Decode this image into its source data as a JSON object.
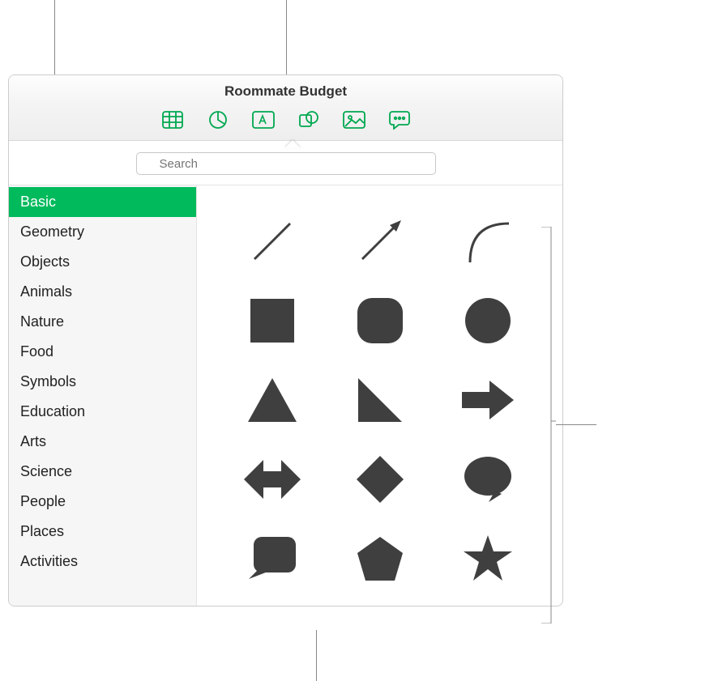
{
  "window": {
    "title": "Roommate Budget"
  },
  "toolbar": {
    "items": [
      {
        "name": "table-icon"
      },
      {
        "name": "chart-icon"
      },
      {
        "name": "text-icon"
      },
      {
        "name": "shape-icon"
      },
      {
        "name": "media-icon"
      },
      {
        "name": "comment-icon"
      }
    ]
  },
  "search": {
    "placeholder": "Search"
  },
  "sidebar": {
    "items": [
      {
        "label": "Basic",
        "selected": true
      },
      {
        "label": "Geometry",
        "selected": false
      },
      {
        "label": "Objects",
        "selected": false
      },
      {
        "label": "Animals",
        "selected": false
      },
      {
        "label": "Nature",
        "selected": false
      },
      {
        "label": "Food",
        "selected": false
      },
      {
        "label": "Symbols",
        "selected": false
      },
      {
        "label": "Education",
        "selected": false
      },
      {
        "label": "Arts",
        "selected": false
      },
      {
        "label": "Science",
        "selected": false
      },
      {
        "label": "People",
        "selected": false
      },
      {
        "label": "Places",
        "selected": false
      },
      {
        "label": "Activities",
        "selected": false
      }
    ]
  },
  "shapes": [
    {
      "name": "line"
    },
    {
      "name": "arrow-line"
    },
    {
      "name": "curve"
    },
    {
      "name": "square"
    },
    {
      "name": "rounded-square"
    },
    {
      "name": "circle"
    },
    {
      "name": "triangle"
    },
    {
      "name": "right-triangle"
    },
    {
      "name": "arrow-right"
    },
    {
      "name": "arrow-bidirectional"
    },
    {
      "name": "diamond"
    },
    {
      "name": "speech-bubble"
    },
    {
      "name": "callout-rect"
    },
    {
      "name": "pentagon"
    },
    {
      "name": "star"
    }
  ],
  "colors": {
    "accent": "#00ba5c",
    "icon": "#00a84f",
    "shape": "#3f3f3f"
  }
}
